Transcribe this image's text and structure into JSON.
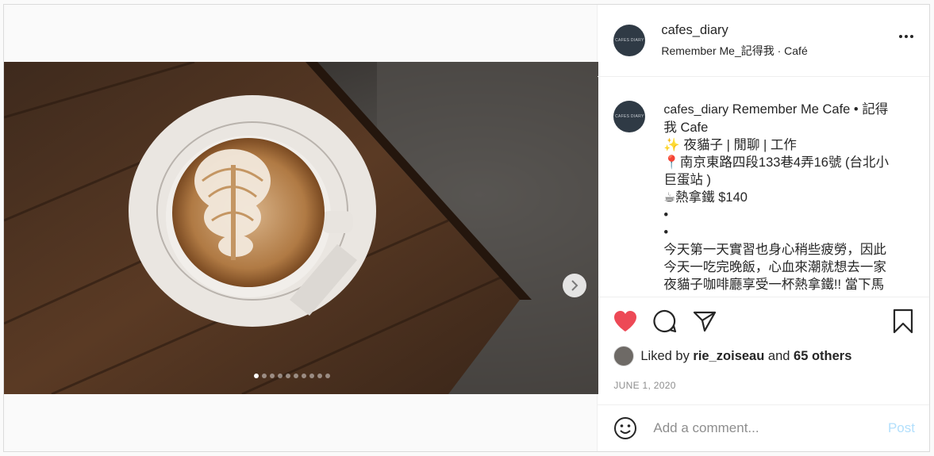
{
  "post": {
    "author": "cafes_diary",
    "avatar_text": "CAFES DIARY",
    "location": "Remember Me_記得我 · Café",
    "caption_lines": [
      "Remember Me Cafe • 記得",
      "我 Cafe",
      "✨ 夜貓子 | 閒聊 | 工作",
      "📍南京東路四段133巷4弄16號 (台北小",
      "巨蛋站 )",
      "☕熱拿鐵 $140",
      "•",
      "•",
      "今天第一天實習也身心稍些疲勞，因此",
      "今天一吃完晚飯，心血來潮就想去一家",
      "夜貓子咖啡廳享受一杯熱拿鐵!! 當下馬"
    ],
    "likes": {
      "prefix": "Liked by",
      "user": "rie_zoiseau",
      "and": "and",
      "others": "65 others"
    },
    "date": "JUNE 1, 2020",
    "comment_placeholder": "Add a comment...",
    "post_label": "Post",
    "carousel": {
      "total": 10,
      "active": 0
    }
  },
  "icons": {
    "like": "heart-filled-icon",
    "comment": "comment-bubble-icon",
    "share": "paper-plane-icon",
    "save": "bookmark-icon",
    "emoji": "smiley-icon",
    "more": "more-dots-icon",
    "next": "chevron-right-icon"
  },
  "colors": {
    "like_red": "#ed4956",
    "post_button_disabled": "#b2dffc",
    "muted_text": "#8e8e8e"
  }
}
